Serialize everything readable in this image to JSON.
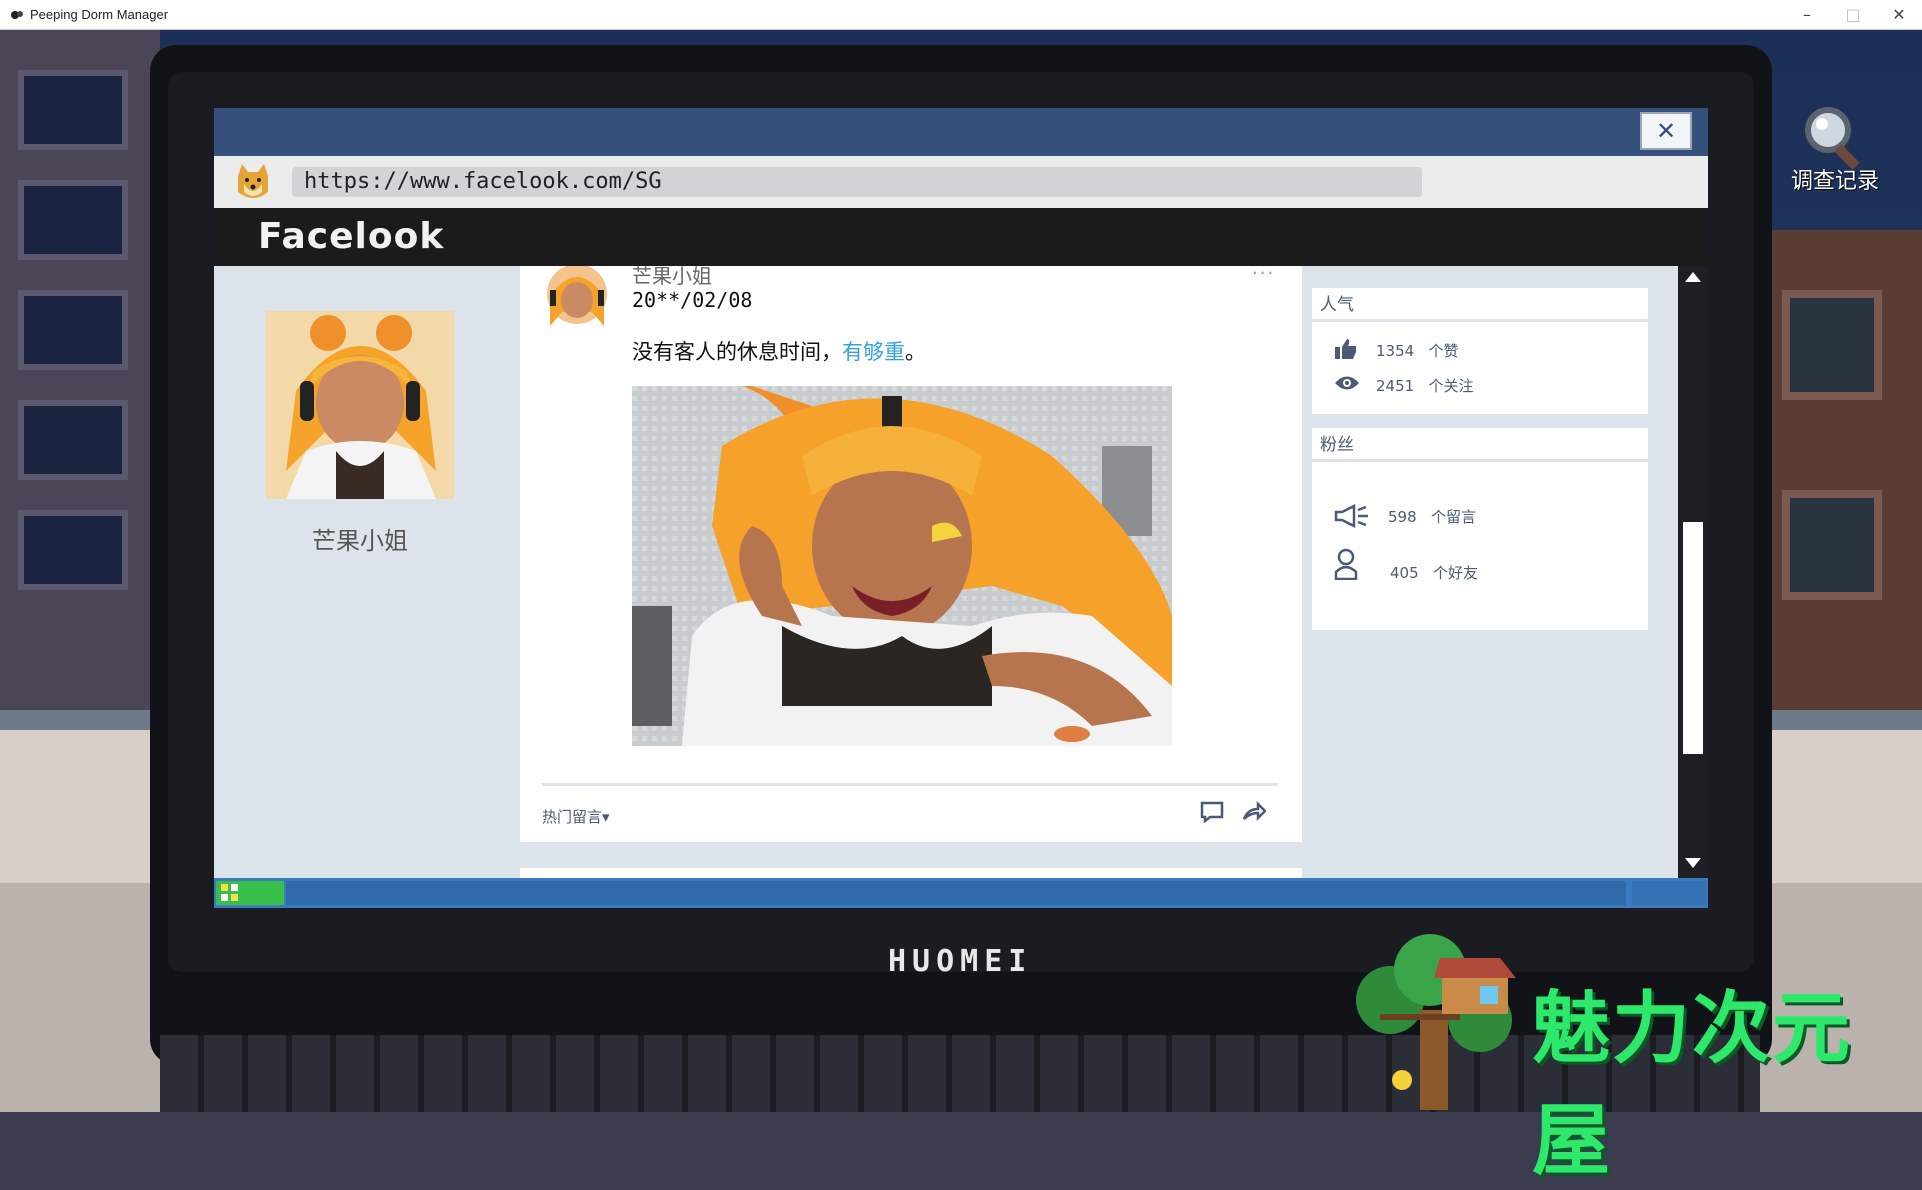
{
  "window": {
    "title": "Peeping Dorm Manager",
    "minimize_glyph": "–",
    "maximize_glyph": "□",
    "close_glyph": "✕"
  },
  "browser": {
    "close_glyph": "✕",
    "url": "https://www.facelook.com/SG",
    "site_name": "Facelook"
  },
  "profile": {
    "name": "芒果小姐"
  },
  "post": {
    "author": "芒果小姐",
    "date": "20**/02/08",
    "text": "没有客人的休息时间，",
    "link_text": "有够重",
    "text_end": "。",
    "menu_glyph": "...",
    "hot_comments_label": "热门留言▾"
  },
  "popularity": {
    "header": "人气",
    "likes_count": "1354",
    "likes_label": "个赞",
    "follows_count": "2451",
    "follows_label": "个关注"
  },
  "fans": {
    "header": "粉丝",
    "messages_count": "598",
    "messages_label": "个留言",
    "friends_count": "405",
    "friends_label": "个好友"
  },
  "laptop": {
    "brand": "HUOMEI"
  },
  "investigation": {
    "label": "调查记录"
  },
  "watermark": {
    "text": "魅力次元屋"
  },
  "colors": {
    "accent_link": "#33a3dc",
    "browser_top": "#35507a",
    "taskbar": "#3a7ac0",
    "start_button": "#38c04a",
    "watermark": "#2de86a"
  }
}
